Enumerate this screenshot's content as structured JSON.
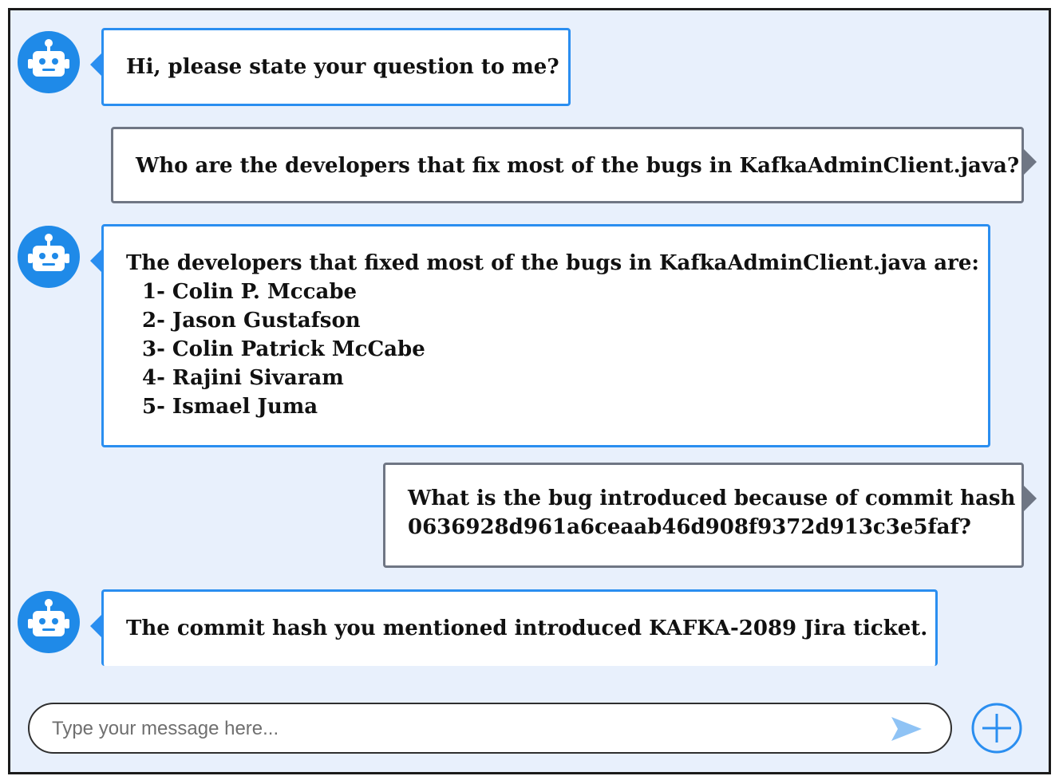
{
  "colors": {
    "background": "#e8f0fc",
    "bot_accent": "#2a8ef0",
    "user_border": "#6f7684",
    "avatar": "#1f8ae8"
  },
  "icons": {
    "avatar": "robot-icon",
    "send": "send-icon",
    "add": "plus-icon"
  },
  "messages": [
    {
      "sender": "bot",
      "text": "Hi, please state your question to me?"
    },
    {
      "sender": "user",
      "text": "Who are the developers that fix most of the bugs in KafkaAdminClient.java?"
    },
    {
      "sender": "bot",
      "text": "The developers that fixed most of the bugs in KafkaAdminClient.java are:",
      "list": [
        "1- Colin P. Mccabe",
        "2- Jason Gustafson",
        "3- Colin Patrick McCabe",
        "4- Rajini Sivaram",
        "5- Ismael Juma"
      ]
    },
    {
      "sender": "user",
      "lines": [
        "What is the bug introduced because of commit hash",
        "0636928d961a6ceaab46d908f9372d913c3e5faf?"
      ]
    },
    {
      "sender": "bot",
      "text": "The commit hash you mentioned introduced KAFKA-2089 Jira ticket."
    }
  ],
  "input": {
    "placeholder": "Type your message here...",
    "value": ""
  }
}
